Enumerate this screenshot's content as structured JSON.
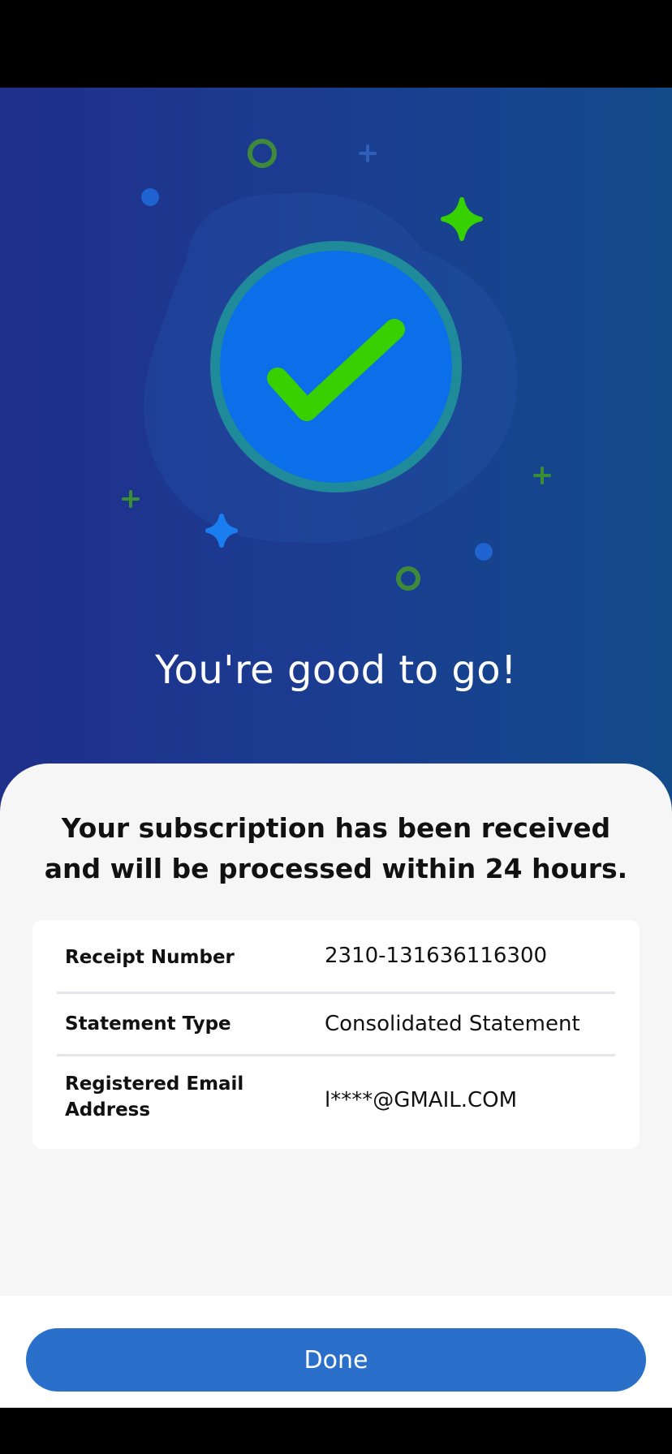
{
  "hero": {
    "title": "You're good to go!"
  },
  "sheet": {
    "message": "Your subscription has been received and will be processed within 24 hours."
  },
  "details": [
    {
      "label": "Receipt Number",
      "value": "2310-131636116300"
    },
    {
      "label": "Statement Type",
      "value": "Consolidated Statement"
    },
    {
      "label": "Registered Email Address",
      "value": "l****@GMAIL.COM"
    }
  ],
  "footer": {
    "done_label": "Done"
  },
  "colors": {
    "accent": "#2a6fc9",
    "success_green": "#38d100",
    "hero_gradient_start": "#1f2f8c",
    "hero_gradient_end": "#124a8a"
  },
  "icons": {
    "success": "check-circle-icon"
  }
}
